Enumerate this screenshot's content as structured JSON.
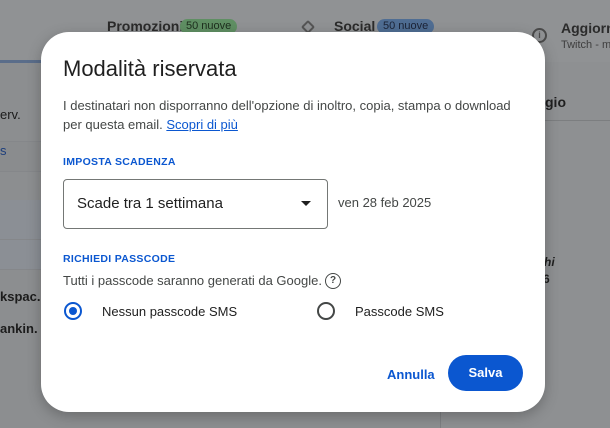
{
  "background": {
    "tabs": {
      "promotions_label": "Promozioni",
      "promotions_badge": "50 nuove",
      "social_label": "Social",
      "social_badge": "50 nuove",
      "updates_label": "Aggiorna",
      "updates_sub": "Twitch - m"
    },
    "rows": [
      "erv.",
      "s",
      "kspac.",
      "ankin. 3"
    ],
    "right_pane": {
      "header": "gio",
      "line1": "hi",
      "line2": "6"
    }
  },
  "dialog": {
    "title": "Modalità riservata",
    "description": "I destinatari non disporranno dell'opzione di inoltro, copia, stampa o download per questa email.",
    "learn_more": "Scopri di più",
    "expiry_section": "IMPOSTA SCADENZA",
    "expiry_value": "Scade tra 1 settimana",
    "expiry_date": "ven 28 feb 2025",
    "passcode_section": "RICHIEDI PASSCODE",
    "passcode_info": "Tutti i passcode saranno generati da Google.",
    "passcode_options": [
      {
        "label": "Nessun passcode SMS",
        "selected": true
      },
      {
        "label": "Passcode SMS",
        "selected": false
      }
    ],
    "cancel_label": "Annulla",
    "save_label": "Salva"
  },
  "colors": {
    "accent": "#0b57d0",
    "scrim": "#8c8e90"
  }
}
